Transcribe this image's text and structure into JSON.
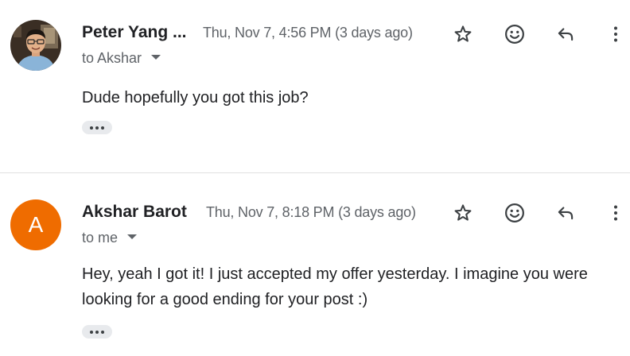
{
  "thread": {
    "messages": [
      {
        "sender": "Peter Yang ...",
        "date": "Thu, Nov 7, 4:56 PM (3 days ago)",
        "recipient": "to Akshar",
        "body": "Dude hopefully you got this job?",
        "avatar": {
          "type": "photo"
        }
      },
      {
        "sender": "Akshar Barot",
        "date": "Thu, Nov 7, 8:18 PM (3 days ago)",
        "recipient": "to me",
        "body": "Hey, yeah I got it! I just accepted my offer yesterday. I imagine you were looking for a good ending for your post :)",
        "avatar": {
          "type": "letter",
          "letter": "A",
          "color": "#ef6c00"
        }
      }
    ]
  },
  "icons": {
    "star": "star-icon",
    "emoji": "emoji-icon",
    "reply": "reply-icon",
    "more": "more-vert-icon",
    "show_trimmed": "ellipsis-icon",
    "dropdown": "caret-down-icon"
  },
  "colors": {
    "primary_text": "#202124",
    "secondary_text": "#5f6368",
    "icon": "#3c4043",
    "divider": "#e0e0e0",
    "chip_bg": "#e8eaed",
    "avatar_orange": "#ef6c00"
  }
}
